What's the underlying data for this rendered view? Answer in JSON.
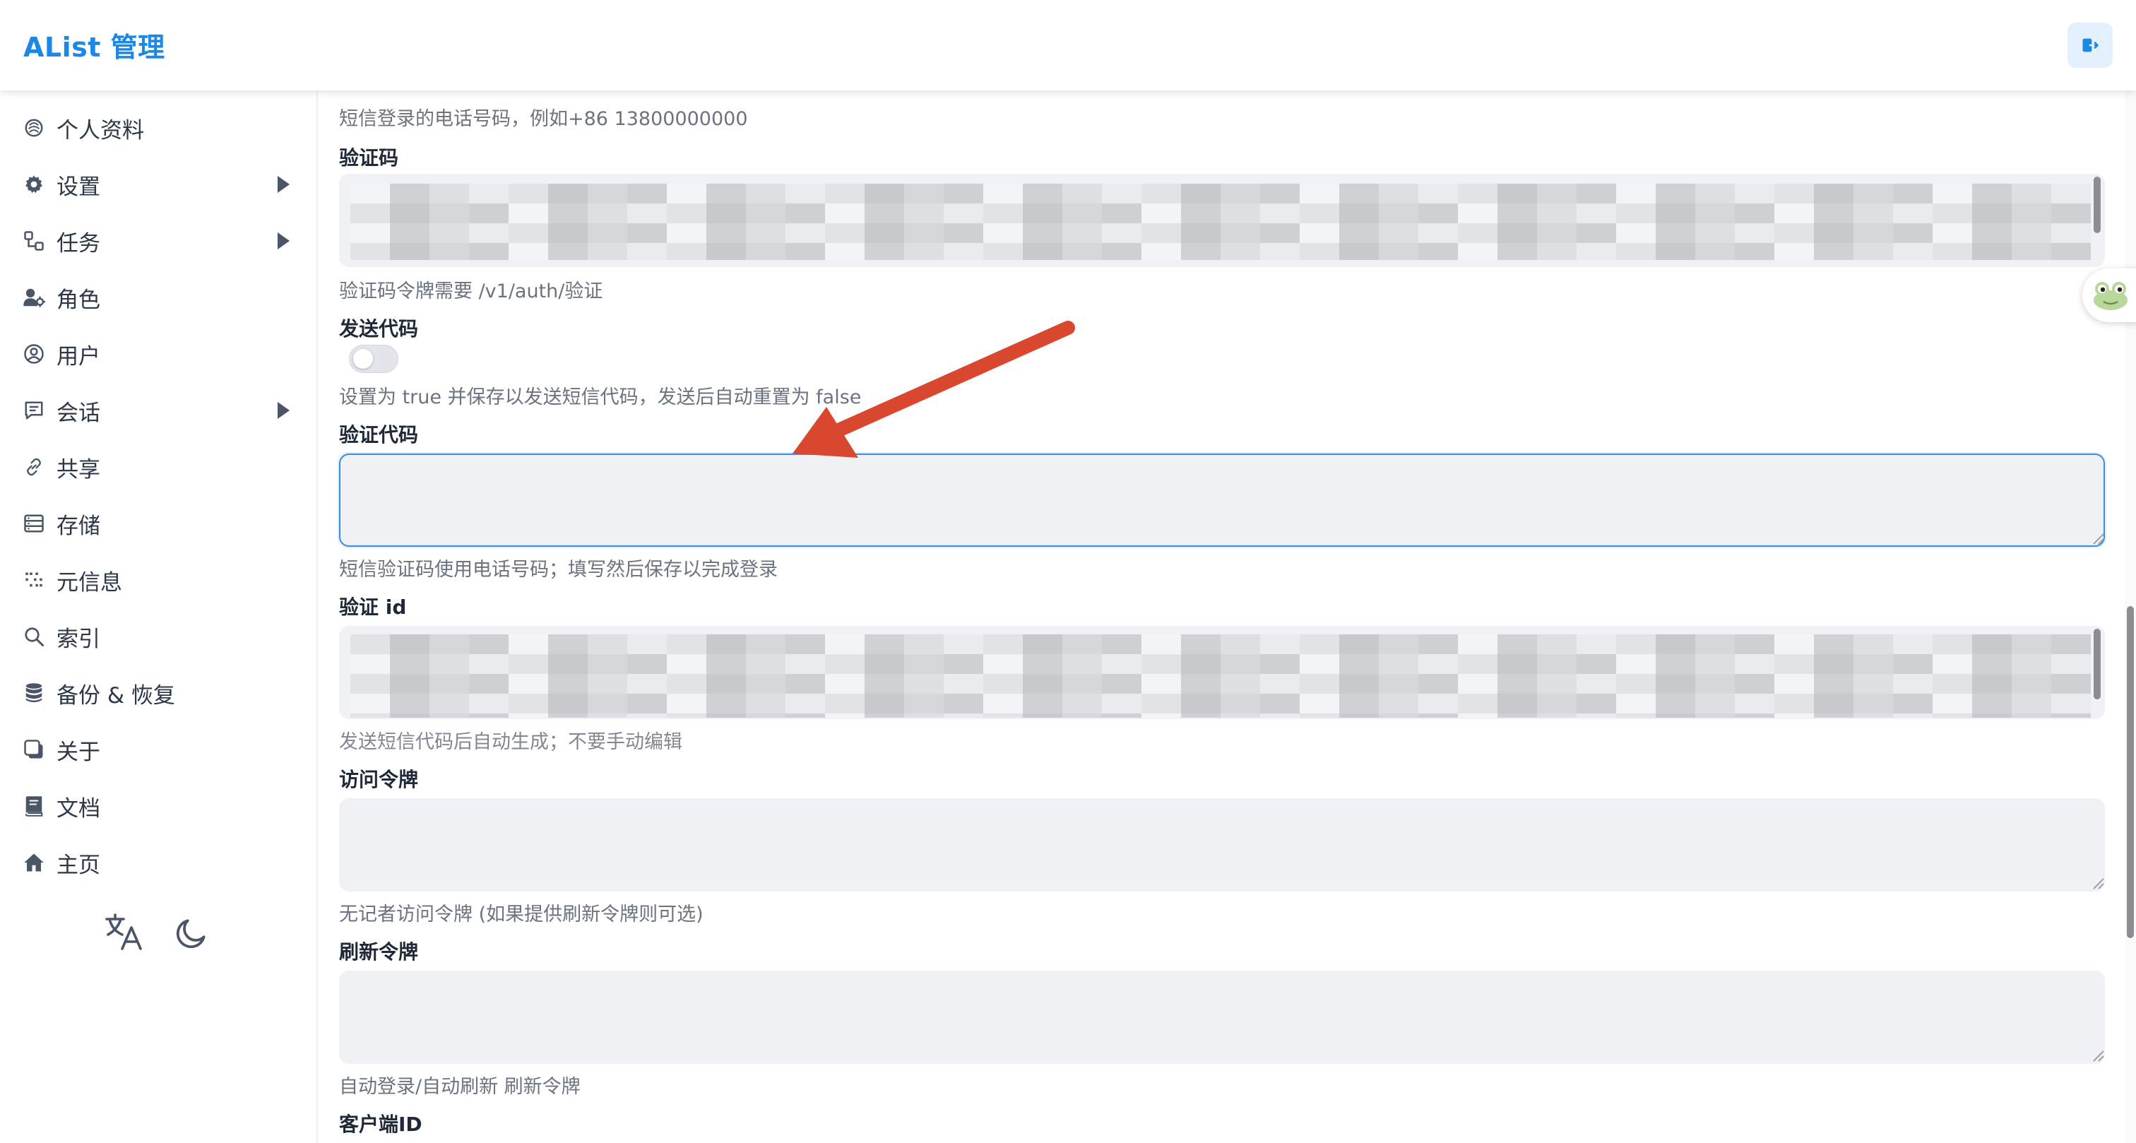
{
  "header": {
    "title": "AList 管理",
    "logout_icon": "logout-icon"
  },
  "sidebar": {
    "items": [
      {
        "label": "个人资料",
        "icon": "profile-icon",
        "has_arrow": false
      },
      {
        "label": "设置",
        "icon": "gear-icon",
        "has_arrow": true
      },
      {
        "label": "任务",
        "icon": "tasks-icon",
        "has_arrow": true
      },
      {
        "label": "角色",
        "icon": "role-icon",
        "has_arrow": false
      },
      {
        "label": "用户",
        "icon": "user-icon",
        "has_arrow": false
      },
      {
        "label": "会话",
        "icon": "session-icon",
        "has_arrow": true
      },
      {
        "label": "共享",
        "icon": "link-icon",
        "has_arrow": false
      },
      {
        "label": "存储",
        "icon": "storage-icon",
        "has_arrow": false
      },
      {
        "label": "元信息",
        "icon": "meta-icon",
        "has_arrow": false
      },
      {
        "label": "索引",
        "icon": "search-icon",
        "has_arrow": false
      },
      {
        "label": "备份 & 恢复",
        "icon": "database-icon",
        "has_arrow": false
      },
      {
        "label": "关于",
        "icon": "about-icon",
        "has_arrow": false
      },
      {
        "label": "文档",
        "icon": "book-icon",
        "has_arrow": false
      },
      {
        "label": "主页",
        "icon": "home-icon",
        "has_arrow": false
      }
    ],
    "tools": {
      "language_icon": "translate-icon",
      "theme_icon": "moon-icon"
    }
  },
  "form": {
    "phone_hint": "短信登录的电话号码，例如+86 13800000000",
    "captcha": {
      "label": "验证码",
      "hint": "验证码令牌需要 /v1/auth/验证"
    },
    "send_code": {
      "label": "发送代码",
      "hint": "设置为 true 并保存以发送短信代码，发送后自动重置为 false",
      "value": false
    },
    "verify_code": {
      "label": "验证代码",
      "value": "",
      "hint": "短信验证码使用电话号码；填写然后保存以完成登录"
    },
    "verify_id": {
      "label": "验证 id",
      "hint": "发送短信代码后自动生成；不要手动编辑"
    },
    "access_token": {
      "label": "访问令牌",
      "value": "",
      "hint": "无记者访问令牌 (如果提供刷新令牌则可选)"
    },
    "refresh_token": {
      "label": "刷新令牌",
      "value": "",
      "hint": "自动登录/自动刷新 刷新令牌"
    },
    "client_id": {
      "label": "客户端ID"
    }
  },
  "colors": {
    "accent": "#1b87e6",
    "annotation_arrow": "#d9472f",
    "input_bg": "#eff1f4",
    "focus_border": "#3b8fe3"
  }
}
